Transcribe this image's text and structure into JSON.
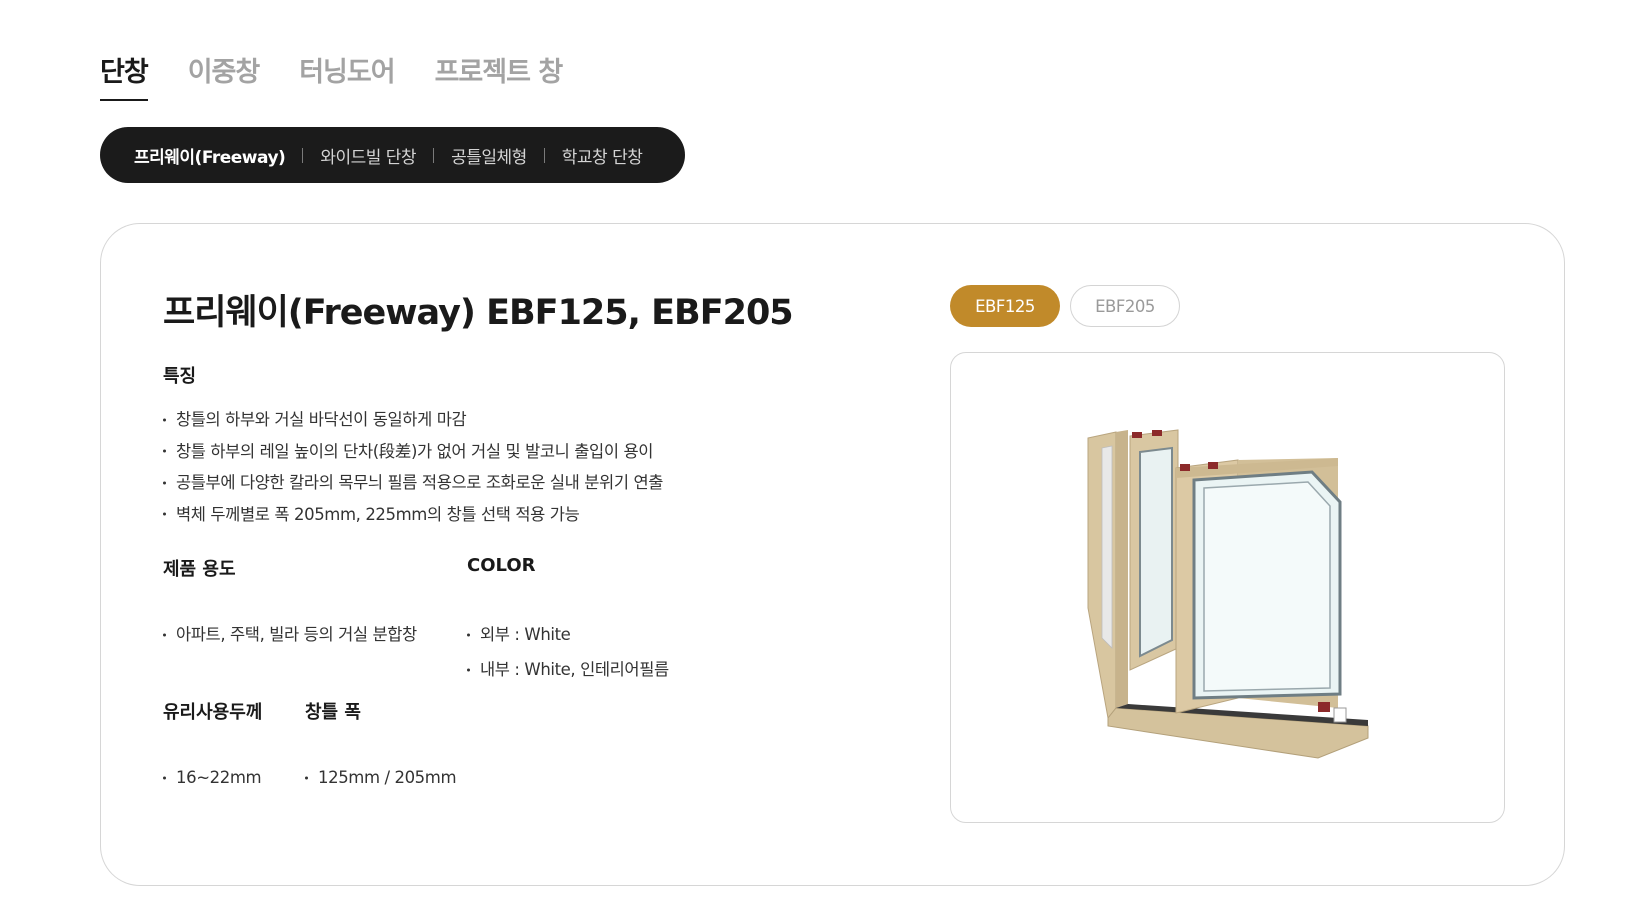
{
  "category_tabs": [
    {
      "label": "단창",
      "active": true
    },
    {
      "label": "이중창",
      "active": false
    },
    {
      "label": "터닝도어",
      "active": false
    },
    {
      "label": "프로젝트 창",
      "active": false
    }
  ],
  "sub_tabs": [
    {
      "label": "프리웨이(Freeway)",
      "active": true
    },
    {
      "label": "와이드빌 단창",
      "active": false
    },
    {
      "label": "공틀일체형",
      "active": false
    },
    {
      "label": "학교창 단창",
      "active": false
    }
  ],
  "product": {
    "title": "프리웨이(Freeway) EBF125, EBF205",
    "features_title": "특징",
    "features": [
      "창틀의 하부와 거실 바닥선이 동일하게 마감",
      "창틀 하부의 레일 높이의 단차(段差)가 없어 거실 및 발코니 출입이 용이",
      "공틀부에 다양한 칼라의 목무늬 필름 적용으로 조화로운 실내 분위기 연출",
      "벽체 두께별로 폭 205mm, 225mm의 창틀 선택 적용 가능"
    ],
    "usage_title": "제품 용도",
    "usage": [
      "아파트, 주택, 빌라 등의 거실 분합창"
    ],
    "color_title": "COLOR",
    "colors": [
      "외부 : White",
      "내부 : White, 인테리어필름"
    ],
    "glass_title": "유리사용두께",
    "glass": [
      "16~22mm"
    ],
    "frame_title": "창틀 폭",
    "frame": [
      "125mm / 205mm"
    ]
  },
  "models": [
    {
      "label": "EBF125",
      "active": true
    },
    {
      "label": "EBF205",
      "active": false
    }
  ],
  "accent_color": "#c18a2a"
}
